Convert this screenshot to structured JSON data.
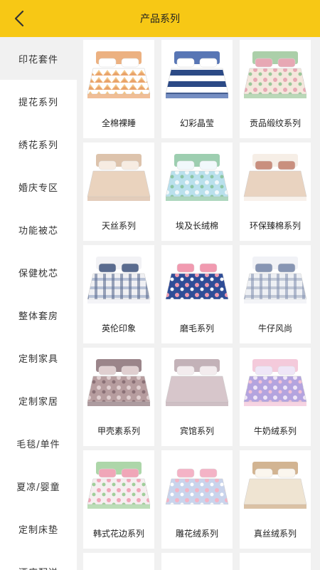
{
  "header": {
    "title": "产品系列",
    "back_icon": "back-arrow-icon"
  },
  "sidebar": {
    "items": [
      {
        "label": "印花套件",
        "active": true
      },
      {
        "label": "提花系列"
      },
      {
        "label": "绣花系列"
      },
      {
        "label": "婚庆专区"
      },
      {
        "label": "功能被芯"
      },
      {
        "label": "保健枕芯"
      },
      {
        "label": "整体套房"
      },
      {
        "label": "定制家具"
      },
      {
        "label": "定制家居"
      },
      {
        "label": "毛毯/单件"
      },
      {
        "label": "夏凉/婴童"
      },
      {
        "label": "定制床垫"
      },
      {
        "label": "酒店配送"
      }
    ]
  },
  "products": [
    {
      "label": "全棉裸睡",
      "pattern": "zigzag",
      "colors": [
        "#f3c98a",
        "#ffffff",
        "#e9a36b"
      ]
    },
    {
      "label": "幻彩晶莹",
      "pattern": "stripes",
      "colors": [
        "#2c4a86",
        "#ffffff",
        "#3b5ea8"
      ]
    },
    {
      "label": "贡品缎纹系列",
      "pattern": "floral",
      "colors": [
        "#f4e7dc",
        "#e7a8b4",
        "#9cc79a"
      ]
    },
    {
      "label": "天丝系列",
      "pattern": "solid",
      "colors": [
        "#ead3be",
        "#f7ece2",
        "#d7b89e"
      ]
    },
    {
      "label": "埃及长绒棉",
      "pattern": "leaf",
      "colors": [
        "#b9e0ec",
        "#f1f8fb",
        "#8cc6a2"
      ]
    },
    {
      "label": "环保臻棉系列",
      "pattern": "solid",
      "colors": [
        "#e9d3c0",
        "#c98f7e",
        "#f5ebe2"
      ]
    },
    {
      "label": "英伦印象",
      "pattern": "plaid",
      "colors": [
        "#b8c2d6",
        "#5a6b8f",
        "#f0f0f3"
      ]
    },
    {
      "label": "磨毛系列",
      "pattern": "floral",
      "colors": [
        "#2f4d97",
        "#f19ab0",
        "#ffffff"
      ]
    },
    {
      "label": "牛仔风尚",
      "pattern": "plaid",
      "colors": [
        "#c1c8d6",
        "#8795b3",
        "#eef0f4"
      ]
    },
    {
      "label": "甲壳素系列",
      "pattern": "floral",
      "colors": [
        "#b79d9f",
        "#e0cfd0",
        "#8a7076"
      ]
    },
    {
      "label": "宾馆系列",
      "pattern": "solid",
      "colors": [
        "#d7c6cb",
        "#f3ecee",
        "#b9a4ab"
      ]
    },
    {
      "label": "牛奶绒系列",
      "pattern": "floral",
      "colors": [
        "#b4a4df",
        "#efe6f7",
        "#f2c1d5"
      ]
    },
    {
      "label": "韩式花边系列",
      "pattern": "floral",
      "colors": [
        "#f6eef0",
        "#f0a6b8",
        "#9fcf9a"
      ]
    },
    {
      "label": "雕花绒系列",
      "pattern": "floral",
      "colors": [
        "#c9d4ec",
        "#f4b3c6",
        "#ffffff"
      ]
    },
    {
      "label": "真丝绒系列",
      "pattern": "solid",
      "colors": [
        "#efe4d2",
        "#fbf6ee",
        "#caa77f"
      ]
    }
  ]
}
